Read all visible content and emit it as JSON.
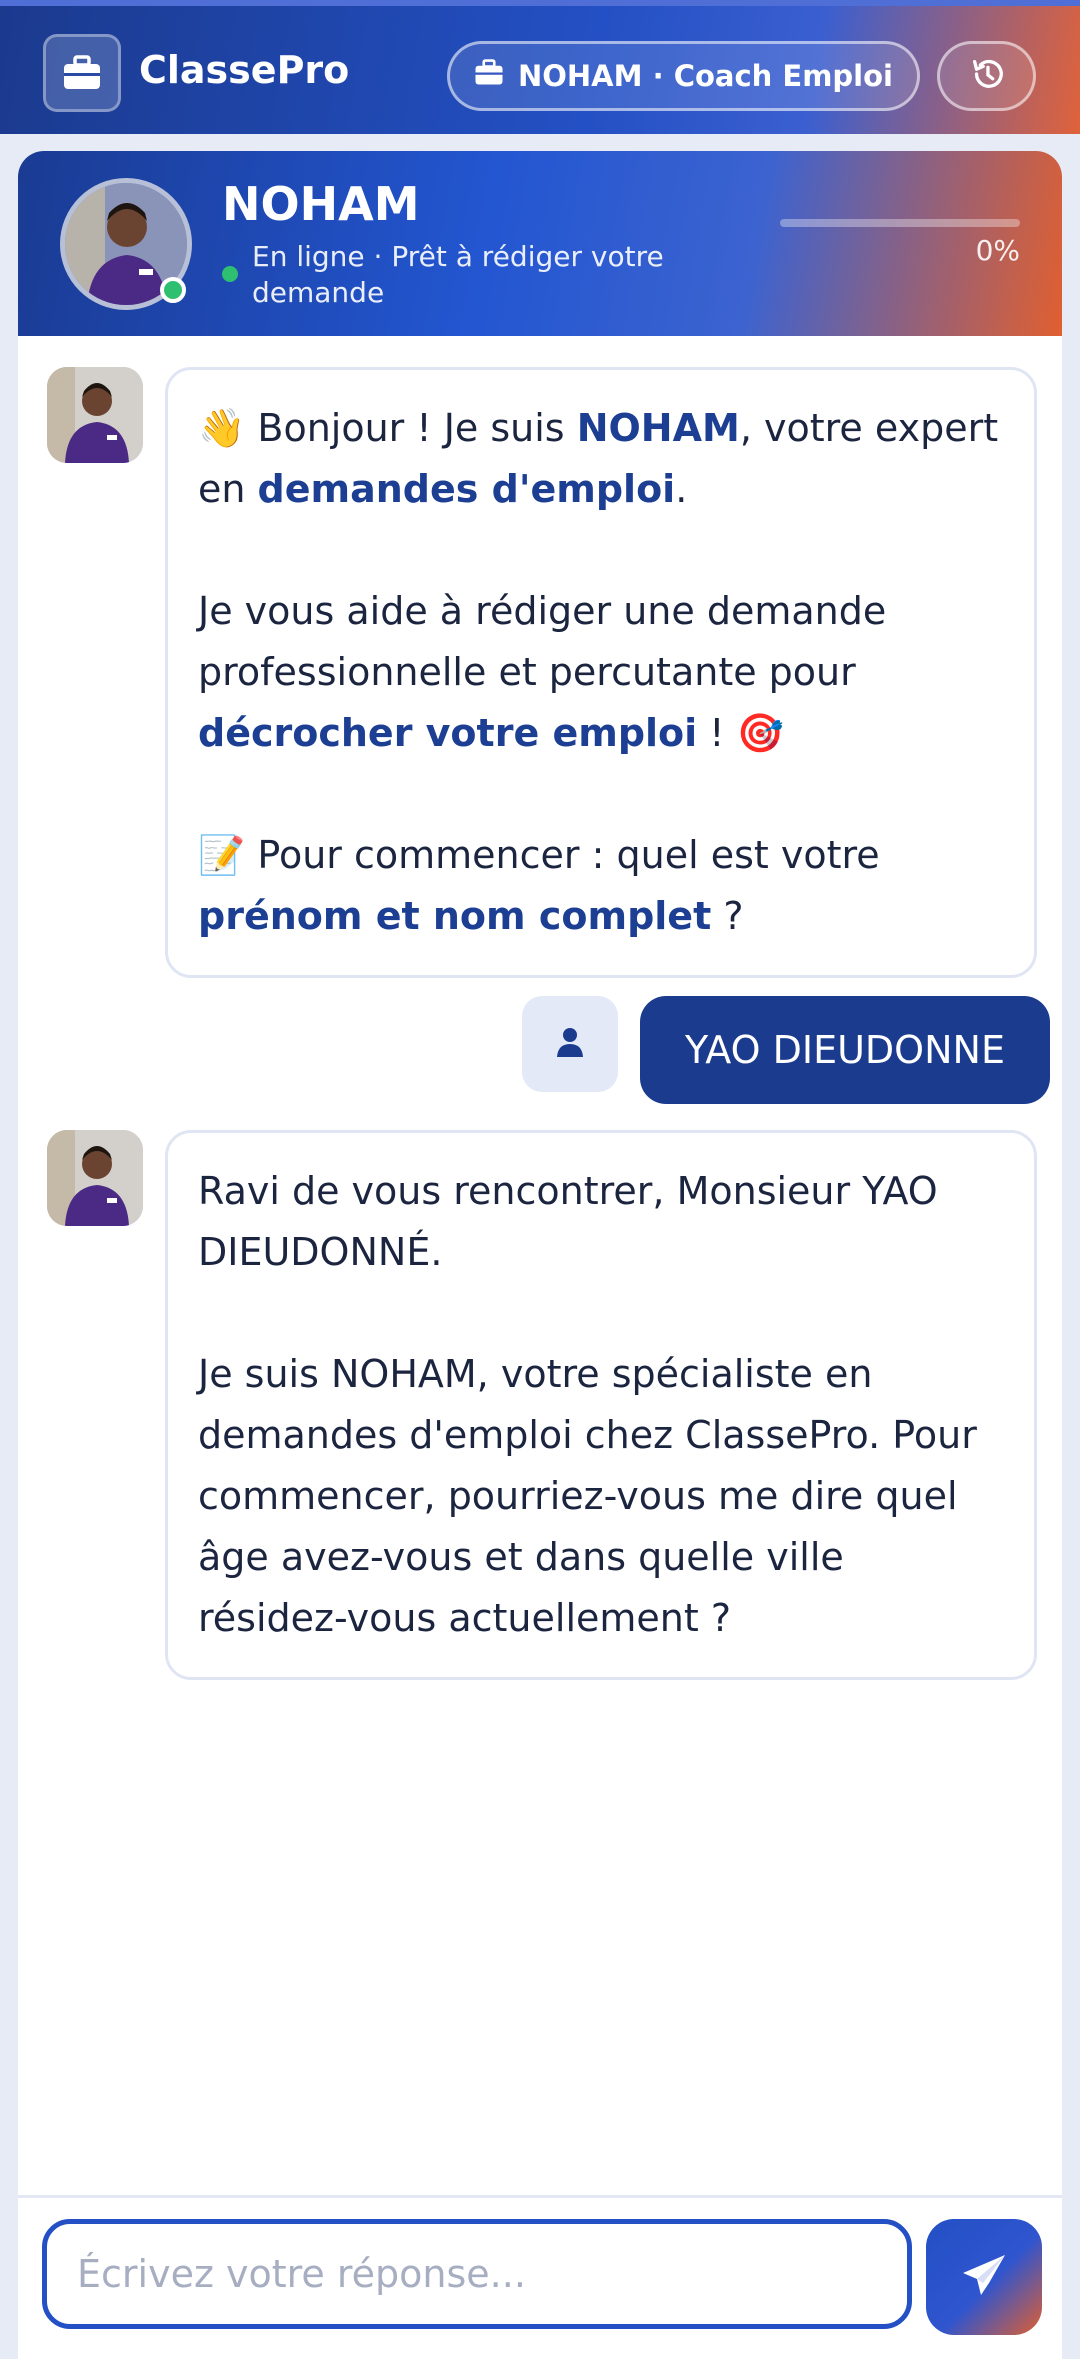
{
  "topbar": {
    "brand": "ClassePro",
    "coach_label": "NOHAM · Coach Emploi"
  },
  "agent": {
    "name": "NOHAM",
    "status": "En ligne · Prêt à rédiger votre demande",
    "progress_label": "0%",
    "progress_value": 0
  },
  "messages": {
    "bot1": {
      "p1_part1": "👋 Bonjour ! Je suis ",
      "p1_bold1": "NOHAM",
      "p1_part2": ", votre expert en ",
      "p1_bold2": "demandes d'emploi",
      "p1_part3": ".",
      "p2_part1": "Je vous aide à rédiger une demande professionnelle et percutante pour ",
      "p2_bold": "décrocher votre emploi",
      "p2_part2": " ! 🎯",
      "p3_part1": "📝 Pour commencer : quel est votre ",
      "p3_bold": "prénom et nom complet",
      "p3_part2": " ?"
    },
    "user1": "YAO DIEUDONNE",
    "bot2": {
      "p1": "Ravi de vous rencontrer, Monsieur YAO DIEUDONNÉ.",
      "p2": "Je suis NOHAM, votre spécialiste en demandes d'emploi chez ClassePro. Pour commencer, pourriez-vous me dire quel âge avez-vous et dans quelle ville résidez-vous actuellement ?"
    }
  },
  "composer": {
    "placeholder": "Écrivez votre réponse..."
  },
  "icons": {
    "brand": "briefcase-icon",
    "coach": "briefcase-icon",
    "history": "history-icon",
    "user": "user-icon",
    "send": "paper-plane-icon"
  }
}
